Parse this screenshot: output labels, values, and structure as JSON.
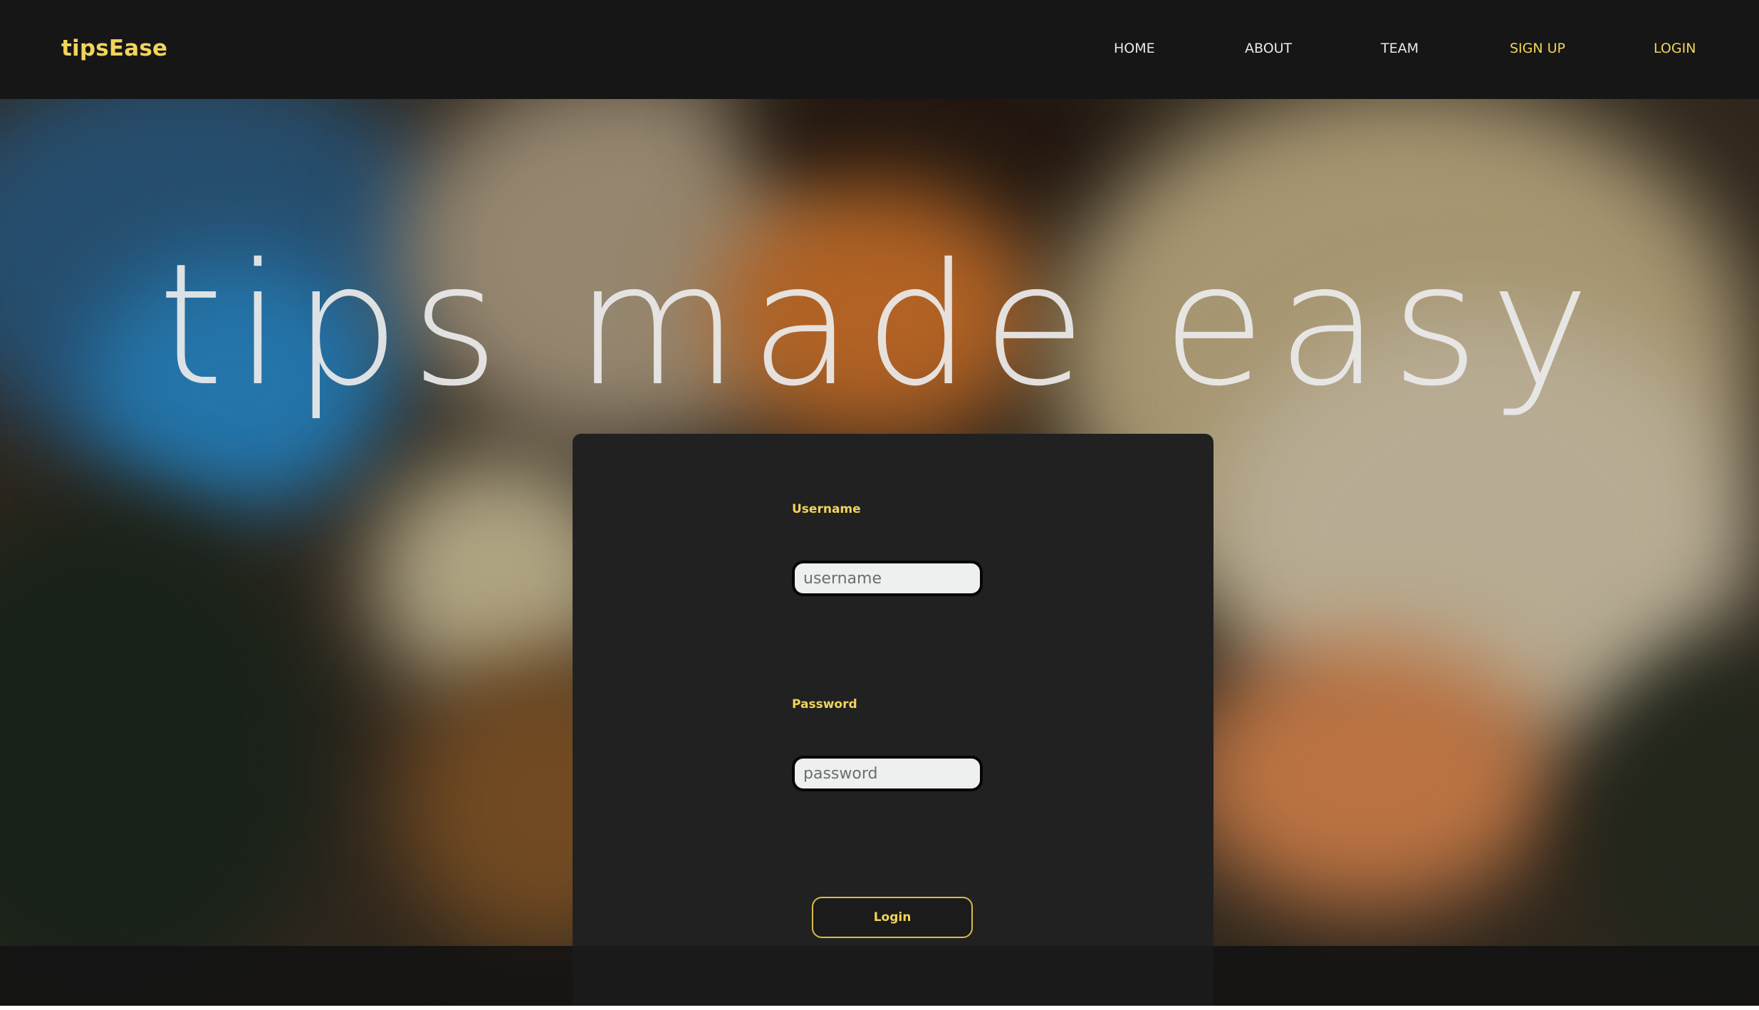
{
  "navbar": {
    "brand": "tipsEase",
    "links": [
      {
        "label": "HOME"
      },
      {
        "label": "ABOUT"
      },
      {
        "label": "TEAM"
      },
      {
        "label": "SIGN UP"
      },
      {
        "label": "LOGIN"
      }
    ]
  },
  "hero": {
    "title": "tips made easy"
  },
  "login_form": {
    "username_label": "Username",
    "username_placeholder": "username",
    "username_value": "",
    "password_label": "Password",
    "password_placeholder": "password",
    "password_value": "",
    "submit_label": "Login"
  },
  "colors": {
    "accent": "#f2d45c",
    "navbar_bg": "#161616",
    "card_bg": "#212121",
    "input_bg": "#eef0ef",
    "nav_text": "#e9e9e9"
  }
}
